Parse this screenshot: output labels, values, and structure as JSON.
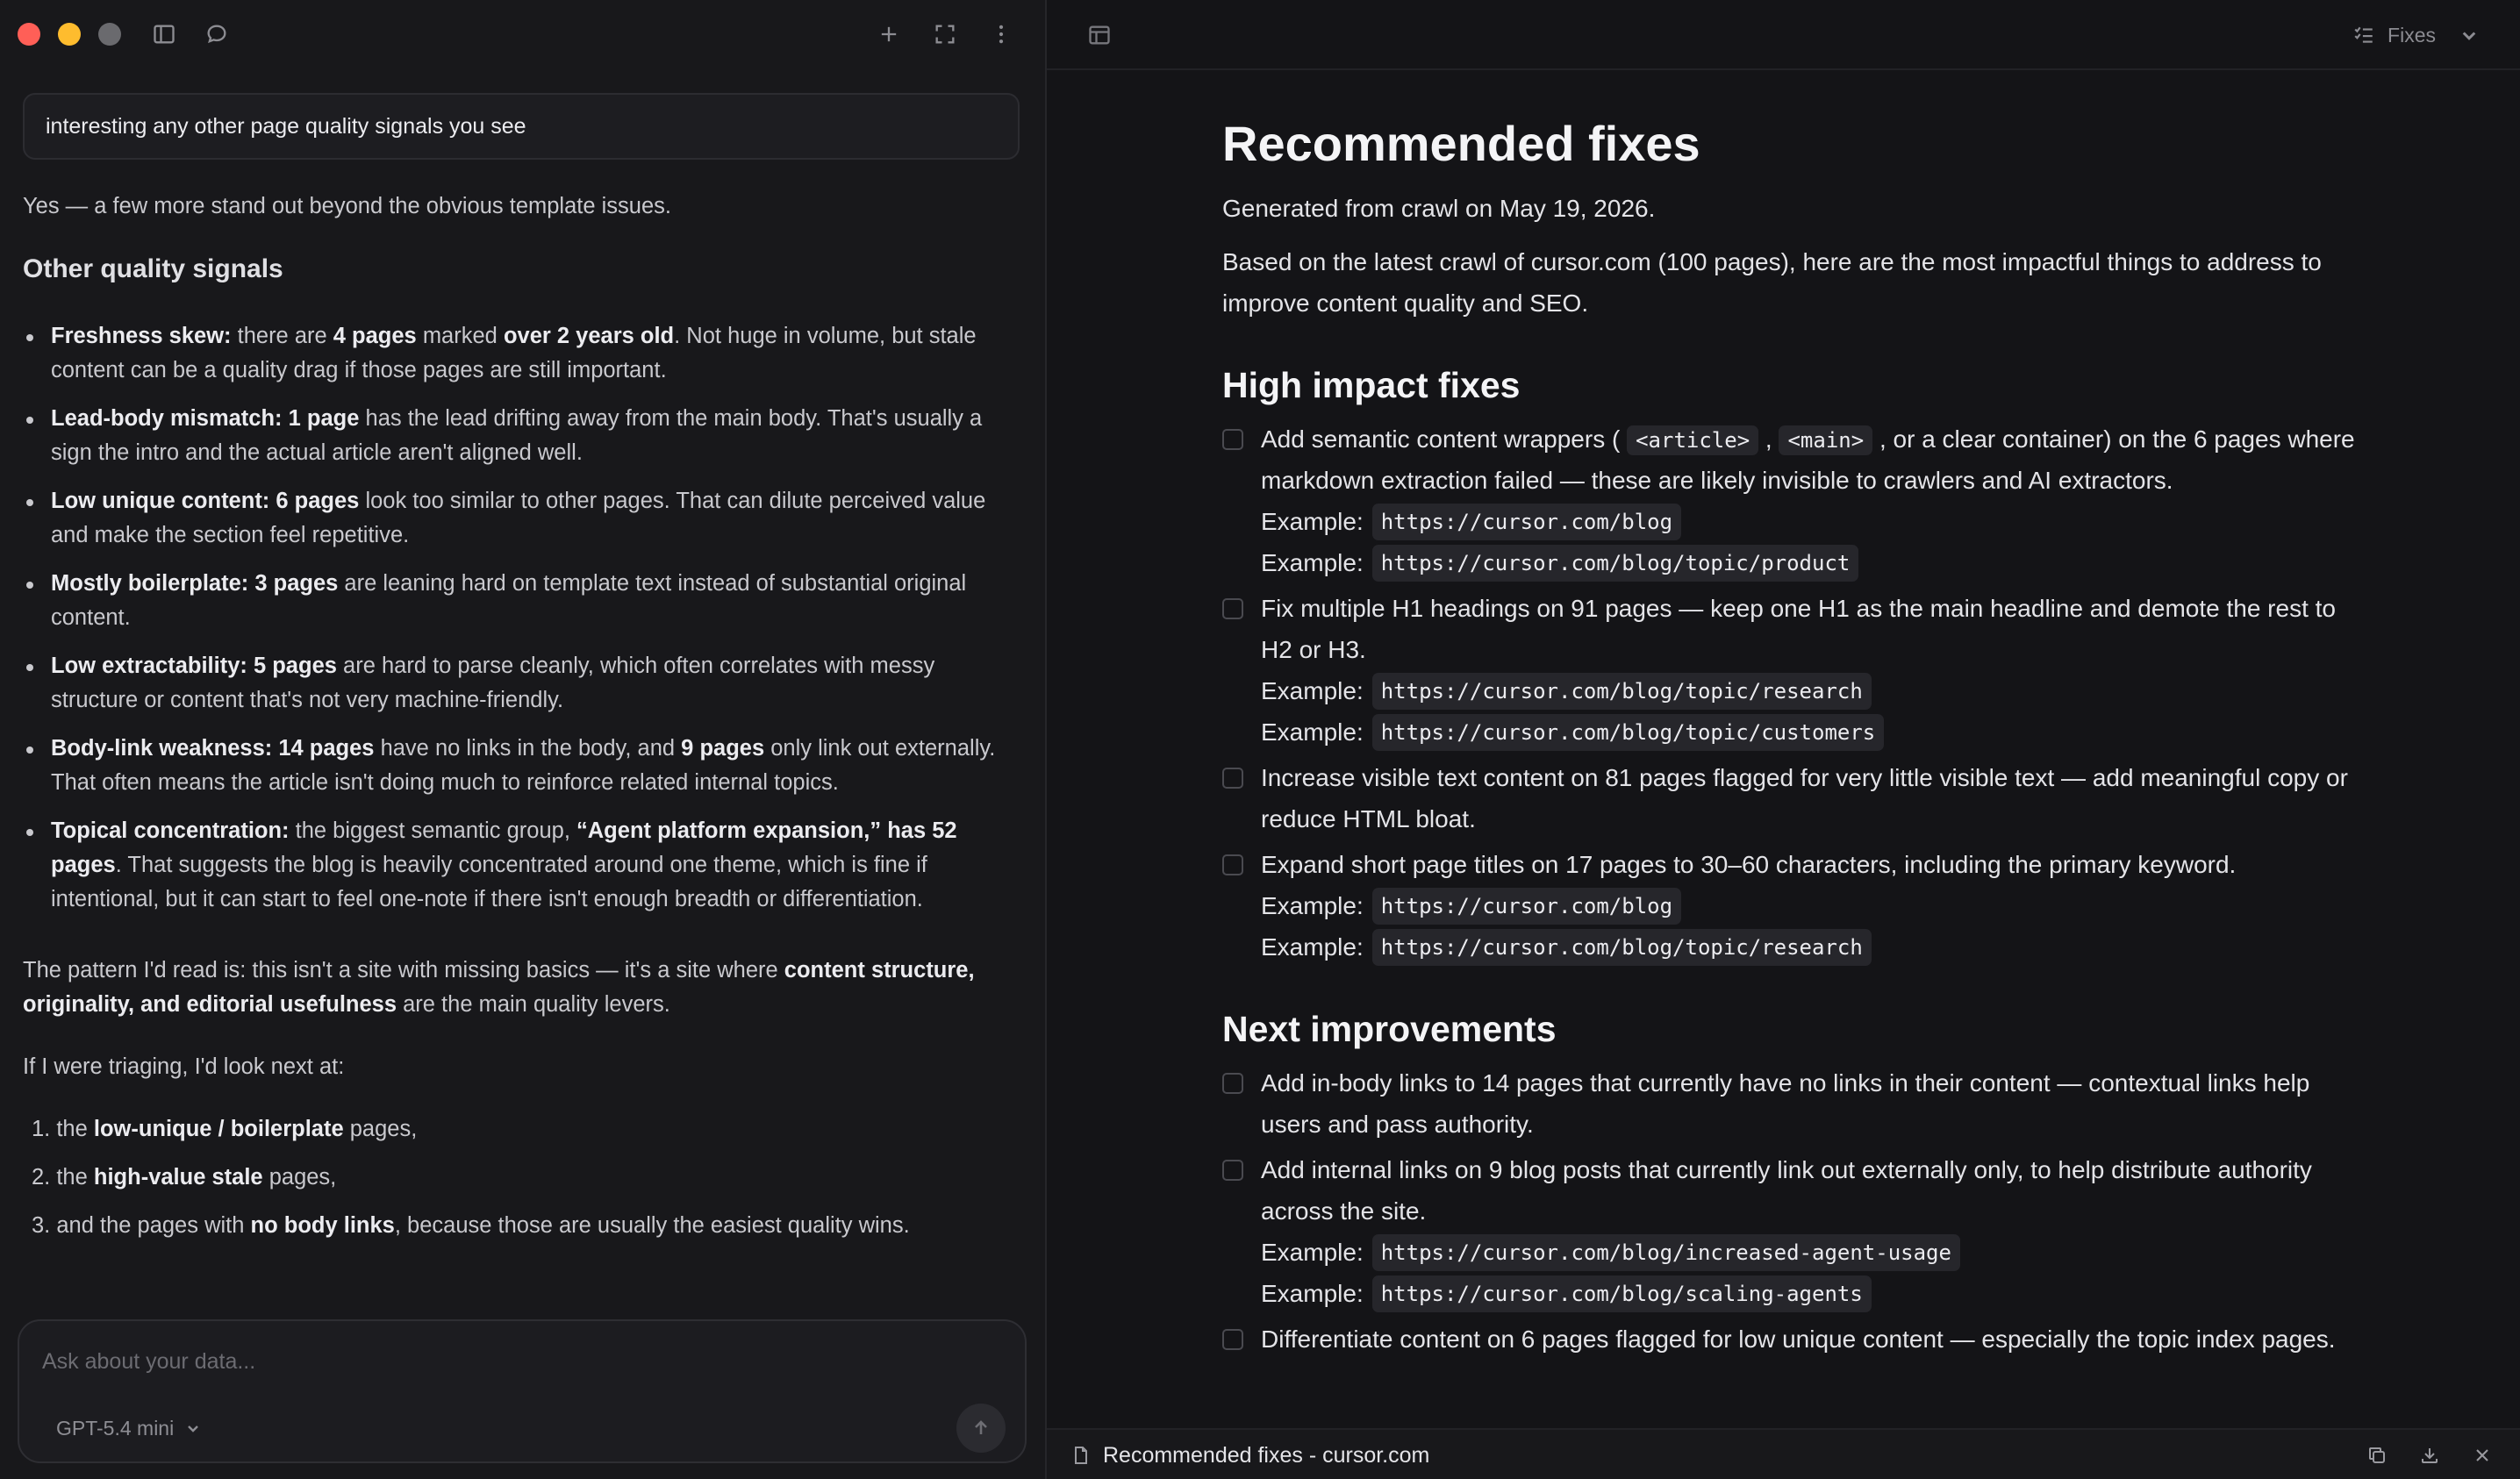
{
  "chat": {
    "prompt": "interesting any other page quality signals you see",
    "reply_intro": "Yes — a few more stand out beyond the obvious template issues.",
    "section_heading": "Other quality signals",
    "signals": [
      {
        "label": "Freshness skew:",
        "parts": [
          {
            "t": " there are ",
            "b": false
          },
          {
            "t": "4 pages",
            "b": true
          },
          {
            "t": " marked ",
            "b": false
          },
          {
            "t": "over 2 years old",
            "b": true
          },
          {
            "t": ". Not huge in volume, but stale content can be a quality drag if those pages are still important.",
            "b": false
          }
        ]
      },
      {
        "label": "Lead-body mismatch: 1 page",
        "parts": [
          {
            "t": " has the lead drifting away from the main body. That's usually a sign the intro and the actual article aren't aligned well.",
            "b": false
          }
        ]
      },
      {
        "label": "Low unique content: 6 pages",
        "parts": [
          {
            "t": " look too similar to other pages. That can dilute perceived value and make the section feel repetitive.",
            "b": false
          }
        ]
      },
      {
        "label": "Mostly boilerplate: 3 pages",
        "parts": [
          {
            "t": " are leaning hard on template text instead of substantial original content.",
            "b": false
          }
        ]
      },
      {
        "label": "Low extractability: 5 pages",
        "parts": [
          {
            "t": " are hard to parse cleanly, which often correlates with messy structure or content that's not very machine-friendly.",
            "b": false
          }
        ]
      },
      {
        "label": "Body-link weakness: 14 pages",
        "parts": [
          {
            "t": " have no links in the body, and ",
            "b": false
          },
          {
            "t": "9 pages",
            "b": true
          },
          {
            "t": " only link out externally. That often means the article isn't doing much to reinforce related internal topics.",
            "b": false
          }
        ]
      },
      {
        "label": "Topical concentration:",
        "parts": [
          {
            "t": " the biggest semantic group, ",
            "b": false
          },
          {
            "t": "“Agent platform expansion,” has 52 pages",
            "b": true
          },
          {
            "t": ". That suggests the blog is heavily concentrated around one theme, which is fine if intentional, but it can start to feel one-note if there isn't enough breadth or differentiation.",
            "b": false
          }
        ]
      }
    ],
    "pattern": [
      {
        "t": "The pattern I'd read is: this isn't a site with missing basics — it's a site where ",
        "b": false
      },
      {
        "t": "content structure, originality, and editorial usefulness",
        "b": true
      },
      {
        "t": " are the main quality levers.",
        "b": false
      }
    ],
    "triage_intro": "If I were triaging, I'd look next at:",
    "triage": [
      [
        {
          "t": "1. the ",
          "b": false
        },
        {
          "t": "low-unique / boilerplate",
          "b": true
        },
        {
          "t": " pages,",
          "b": false
        }
      ],
      [
        {
          "t": "2. the ",
          "b": false
        },
        {
          "t": "high-value stale",
          "b": true
        },
        {
          "t": " pages,",
          "b": false
        }
      ],
      [
        {
          "t": "3. and the pages with ",
          "b": false
        },
        {
          "t": "no body links",
          "b": true
        },
        {
          "t": ", because those are usually the easiest quality wins.",
          "b": false
        }
      ]
    ]
  },
  "composer": {
    "placeholder": "Ask about your data...",
    "model": "GPT-5.4 mini"
  },
  "right_header": {
    "panel_label": "Fixes"
  },
  "document": {
    "title": "Recommended fixes",
    "generated": "Generated from crawl on May 19, 2026.",
    "intro": "Based on the latest crawl of cursor.com (100 pages), here are the most impactful things to address to improve content quality and SEO.",
    "example_label": "Example:",
    "high_impact": {
      "heading": "High impact fixes",
      "items": [
        {
          "parts": [
            {
              "t": "Add semantic content wrappers ( ",
              "c": false
            },
            {
              "t": "<article>",
              "c": true
            },
            {
              "t": " , ",
              "c": false
            },
            {
              "t": "<main>",
              "c": true
            },
            {
              "t": " , or a clear container) on the 6 pages where markdown extraction failed — these are likely invisible to crawlers and AI extractors.",
              "c": false
            }
          ],
          "examples": [
            "https://cursor.com/blog",
            "https://cursor.com/blog/topic/product"
          ]
        },
        {
          "parts": [
            {
              "t": "Fix multiple H1 headings on 91 pages — keep one H1 as the main headline and demote the rest to H2 or H3.",
              "c": false
            }
          ],
          "examples": [
            "https://cursor.com/blog/topic/research",
            "https://cursor.com/blog/topic/customers"
          ]
        },
        {
          "parts": [
            {
              "t": "Increase visible text content on 81 pages flagged for very little visible text — add meaningful copy or reduce HTML bloat.",
              "c": false
            }
          ],
          "examples": []
        },
        {
          "parts": [
            {
              "t": "Expand short page titles on 17 pages to 30–60 characters, including the primary keyword.",
              "c": false
            }
          ],
          "examples": [
            "https://cursor.com/blog",
            "https://cursor.com/blog/topic/research"
          ]
        }
      ]
    },
    "next": {
      "heading": "Next improvements",
      "items": [
        {
          "parts": [
            {
              "t": "Add in-body links to 14 pages that currently have no links in their content — contextual links help users and pass authority.",
              "c": false
            }
          ],
          "examples": []
        },
        {
          "parts": [
            {
              "t": "Add internal links on 9 blog posts that currently link out externally only, to help distribute authority across the site.",
              "c": false
            }
          ],
          "examples": [
            "https://cursor.com/blog/increased-agent-usage",
            "https://cursor.com/blog/scaling-agents"
          ]
        },
        {
          "parts": [
            {
              "t": "Differentiate content on 6 pages flagged for low unique content — especially the topic index pages.",
              "c": false
            }
          ],
          "examples": []
        }
      ]
    }
  },
  "footer": {
    "doc_title": "Recommended fixes - cursor.com"
  },
  "colors": {
    "traffic_red": "#ff5f57",
    "traffic_yellow": "#febc2e",
    "background": "#131316"
  }
}
